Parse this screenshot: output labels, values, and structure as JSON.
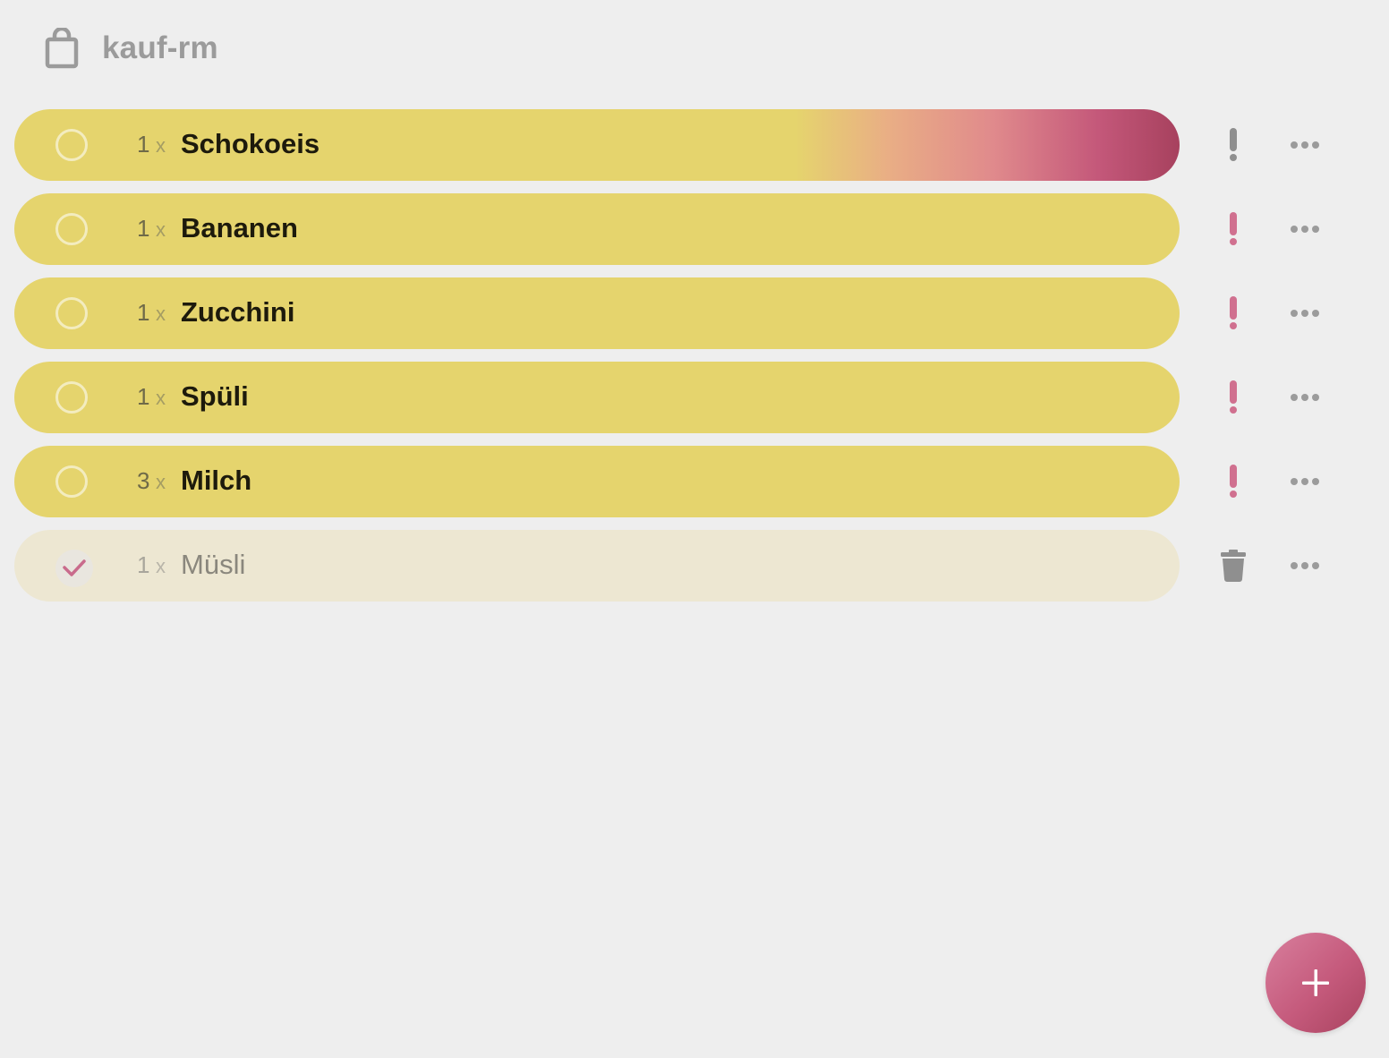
{
  "app": {
    "title": "kauf-rm",
    "icon": "shopping-bag-icon"
  },
  "colors": {
    "background": "#eeeeee",
    "item_pill": "#e5d46d",
    "item_pill_done": "#ede7d2",
    "accent": "#c55a7c",
    "priority_active": "#d0708f",
    "priority_inactive": "#8f8f8f",
    "icon_gray": "#9b9b9b"
  },
  "items": [
    {
      "qty": "1",
      "times": "x",
      "name": "Schokoeis",
      "done": false,
      "priority_icon": "exclamation-icon",
      "priority_state": "inactive",
      "highlight": "gradient"
    },
    {
      "qty": "1",
      "times": "x",
      "name": "Bananen",
      "done": false,
      "priority_icon": "exclamation-icon",
      "priority_state": "active"
    },
    {
      "qty": "1",
      "times": "x",
      "name": "Zucchini",
      "done": false,
      "priority_icon": "exclamation-icon",
      "priority_state": "active"
    },
    {
      "qty": "1",
      "times": "x",
      "name": "Spüli",
      "done": false,
      "priority_icon": "exclamation-icon",
      "priority_state": "active"
    },
    {
      "qty": "3",
      "times": "x",
      "name": "Milch",
      "done": false,
      "priority_icon": "exclamation-icon",
      "priority_state": "active"
    },
    {
      "qty": "1",
      "times": "x",
      "name": "Müsli",
      "done": true,
      "action_icon": "trash-icon"
    }
  ],
  "fab": {
    "icon": "plus-icon"
  }
}
